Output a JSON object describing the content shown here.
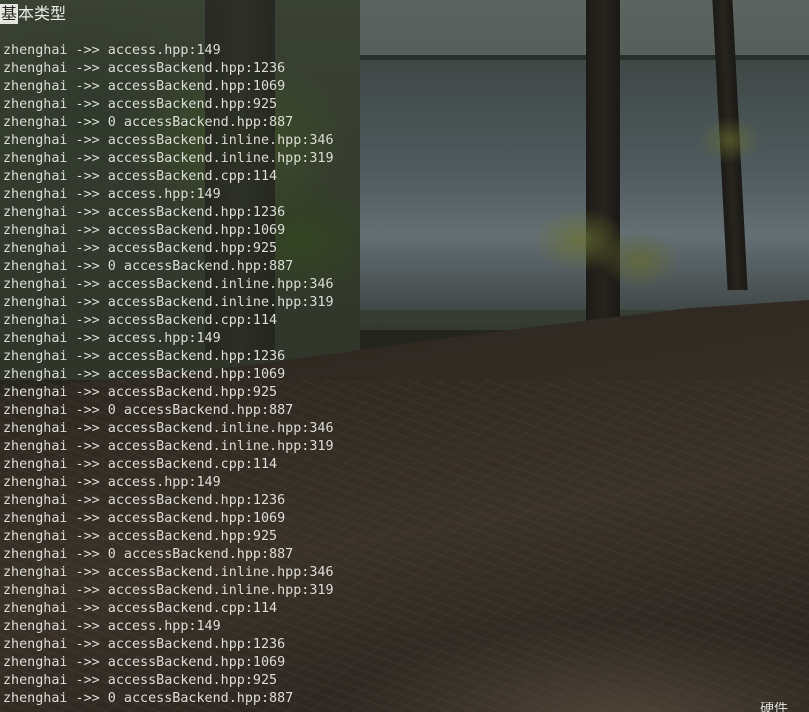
{
  "terminal": {
    "cursor_char": "基",
    "title_rest": "本类型",
    "lines": [
      "zhenghai ->> access.hpp:149",
      "zhenghai ->> accessBackend.hpp:1236",
      "zhenghai ->> accessBackend.hpp:1069",
      "zhenghai ->> accessBackend.hpp:925",
      "zhenghai ->> 0 accessBackend.hpp:887",
      "zhenghai ->> accessBackend.inline.hpp:346",
      "zhenghai ->> accessBackend.inline.hpp:319",
      "zhenghai ->> accessBackend.cpp:114",
      "zhenghai ->> access.hpp:149",
      "zhenghai ->> accessBackend.hpp:1236",
      "zhenghai ->> accessBackend.hpp:1069",
      "zhenghai ->> accessBackend.hpp:925",
      "zhenghai ->> 0 accessBackend.hpp:887",
      "zhenghai ->> accessBackend.inline.hpp:346",
      "zhenghai ->> accessBackend.inline.hpp:319",
      "zhenghai ->> accessBackend.cpp:114",
      "zhenghai ->> access.hpp:149",
      "zhenghai ->> accessBackend.hpp:1236",
      "zhenghai ->> accessBackend.hpp:1069",
      "zhenghai ->> accessBackend.hpp:925",
      "zhenghai ->> 0 accessBackend.hpp:887",
      "zhenghai ->> accessBackend.inline.hpp:346",
      "zhenghai ->> accessBackend.inline.hpp:319",
      "zhenghai ->> accessBackend.cpp:114",
      "zhenghai ->> access.hpp:149",
      "zhenghai ->> accessBackend.hpp:1236",
      "zhenghai ->> accessBackend.hpp:1069",
      "zhenghai ->> accessBackend.hpp:925",
      "zhenghai ->> 0 accessBackend.hpp:887",
      "zhenghai ->> accessBackend.inline.hpp:346",
      "zhenghai ->> accessBackend.inline.hpp:319",
      "zhenghai ->> accessBackend.cpp:114",
      "zhenghai ->> access.hpp:149",
      "zhenghai ->> accessBackend.hpp:1236",
      "zhenghai ->> accessBackend.hpp:1069",
      "zhenghai ->> accessBackend.hpp:925",
      "zhenghai ->> 0 accessBackend.hpp:887"
    ],
    "corner_text": "硬件"
  },
  "colors": {
    "text": "#dcdcd6",
    "cursor_bg": "#e6e6e0"
  }
}
